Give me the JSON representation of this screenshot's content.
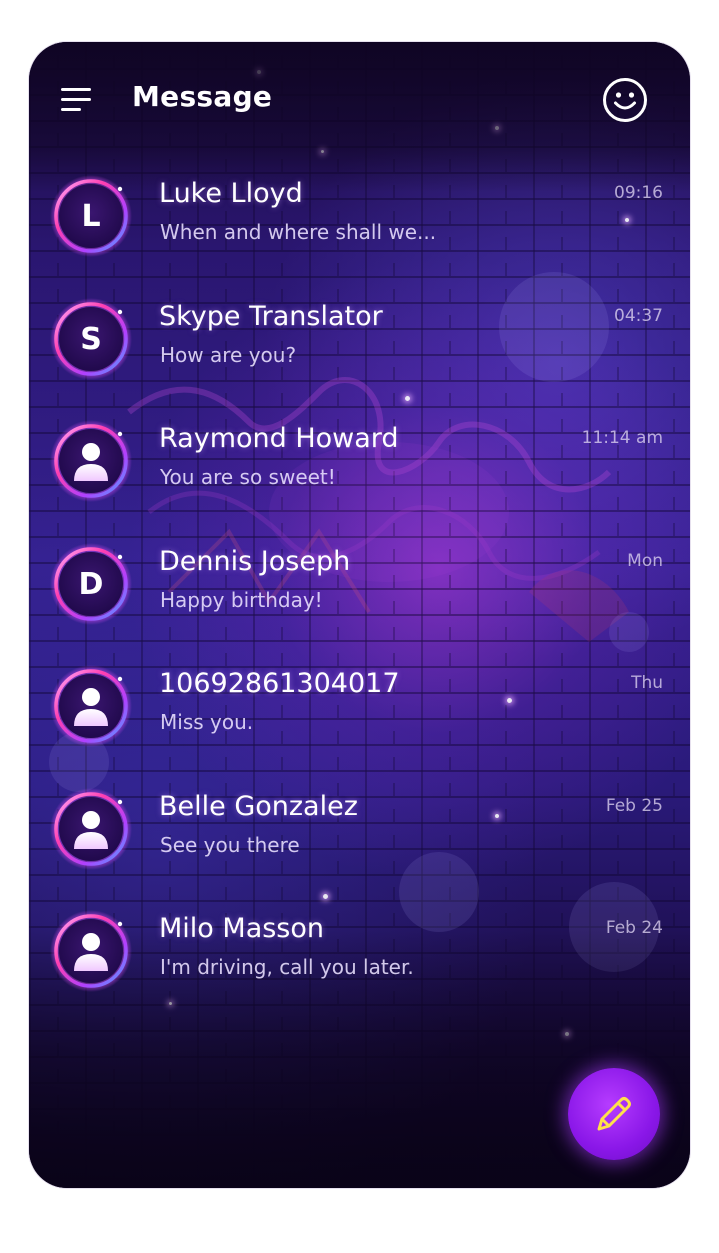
{
  "app": {
    "title": "Message"
  },
  "header": {
    "menu_icon": "hamburger-menu-icon",
    "emoji_icon": "smiley-icon"
  },
  "conversations": [
    {
      "avatar_type": "letter",
      "initial": "L",
      "name": "Luke Lloyd",
      "preview": "When and where shall we...",
      "time": "09:16"
    },
    {
      "avatar_type": "letter",
      "initial": "S",
      "name": "Skype Translator",
      "preview": "How are you?",
      "time": "04:37"
    },
    {
      "avatar_type": "person",
      "initial": "",
      "name": "Raymond Howard",
      "preview": "You are so sweet!",
      "time": "11:14 am"
    },
    {
      "avatar_type": "letter",
      "initial": "D",
      "name": "Dennis Joseph",
      "preview": "Happy birthday!",
      "time": "Mon"
    },
    {
      "avatar_type": "person",
      "initial": "",
      "name": "10692861304017",
      "preview": "Miss you.",
      "time": "Thu"
    },
    {
      "avatar_type": "person",
      "initial": "",
      "name": "Belle Gonzalez",
      "preview": "See you there",
      "time": "Feb 25"
    },
    {
      "avatar_type": "person",
      "initial": "",
      "name": "Milo Masson",
      "preview": "I'm driving, call you later.",
      "time": "Feb 24"
    }
  ],
  "compose": {
    "icon": "pencil-icon"
  },
  "colors": {
    "accent": "#9b25f2",
    "ring_pink": "#ff3fb0",
    "ring_blue": "#4aa8ff",
    "text": "#ffffff"
  }
}
